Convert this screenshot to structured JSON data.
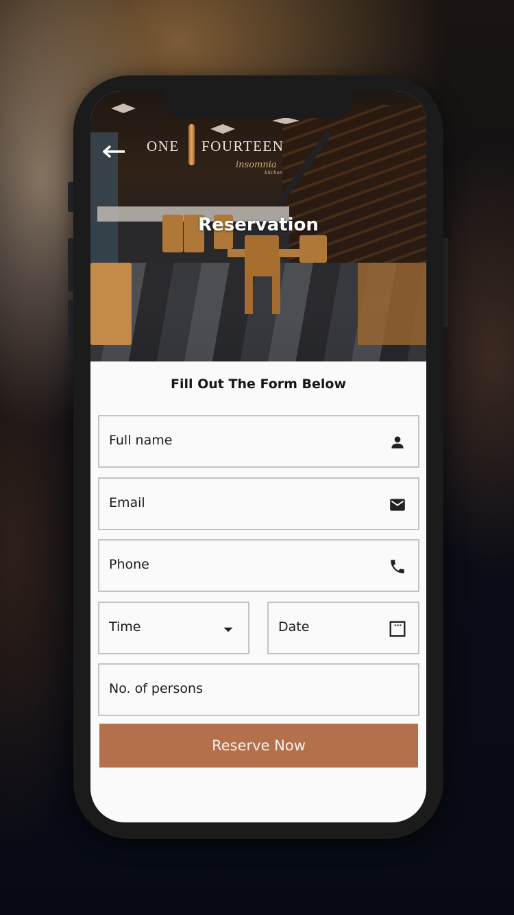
{
  "header": {
    "back_icon": "arrow-left-icon",
    "logo": {
      "word1": "ONE",
      "word2": "FOURTEEN",
      "sub": "insomnia",
      "sub2": "kitchen"
    },
    "title": "Reservation"
  },
  "form": {
    "heading": "Fill Out The Form Below",
    "fields": {
      "full_name": {
        "placeholder": "Full name",
        "value": "",
        "icon": "person-icon"
      },
      "email": {
        "placeholder": "Email",
        "value": "",
        "icon": "mail-icon"
      },
      "phone": {
        "placeholder": "Phone",
        "value": "",
        "icon": "phone-icon"
      },
      "time": {
        "placeholder": "Time",
        "value": "",
        "icon": "dropdown-arrow-icon"
      },
      "date": {
        "placeholder": "Date",
        "value": "",
        "icon": "calendar-icon"
      },
      "persons": {
        "placeholder": "No. of persons",
        "value": ""
      }
    },
    "submit_label": "Reserve Now"
  },
  "colors": {
    "accent": "#b3704a",
    "field_border": "#c4c4c4",
    "screen_bg": "#fafafa",
    "text": "#1b1b1b"
  }
}
